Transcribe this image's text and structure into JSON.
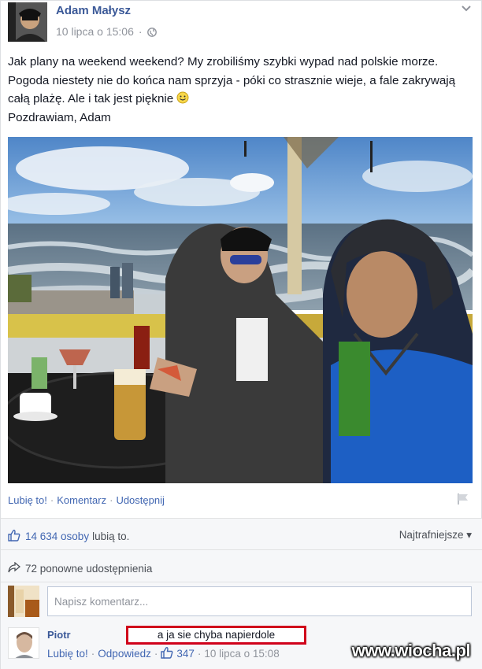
{
  "post": {
    "author": "Adam Małysz",
    "date": "10 lipca o 15:06",
    "separator": "·",
    "text": "Jak plany na weekend weekend? My zrobiliśmy szybki wypad nad polskie morze. Pogoda niestety nie do końca nam sprzyja - póki co strasznie wieje, a fale zakrywają całą plażę. Ale i tak jest pięknie ",
    "signoff": "Pozdrawiam, Adam"
  },
  "actions": {
    "like": "Lubię to!",
    "comment": "Komentarz",
    "share": "Udostępnij",
    "sep": "·"
  },
  "feedback": {
    "likes_count": "14 634 osoby",
    "likes_text": "lubią to.",
    "sort": "Najtrafniejsze ▾",
    "shares_count": "72 ponowne udostępnienia",
    "comment_placeholder": "Napisz komentarz..."
  },
  "comment": {
    "author": "Piotr",
    "text": "a ja sie chyba napierdole",
    "like": "Lubię to!",
    "reply": "Odpowiedz",
    "likes": "347",
    "time": "10 lipca o 15:08",
    "sep": "·"
  },
  "watermark": "www.wiocha.pl",
  "colors": {
    "link": "#3b5998",
    "accent": "#4267b2",
    "muted": "#90949c",
    "highlight": "#d0021b"
  }
}
